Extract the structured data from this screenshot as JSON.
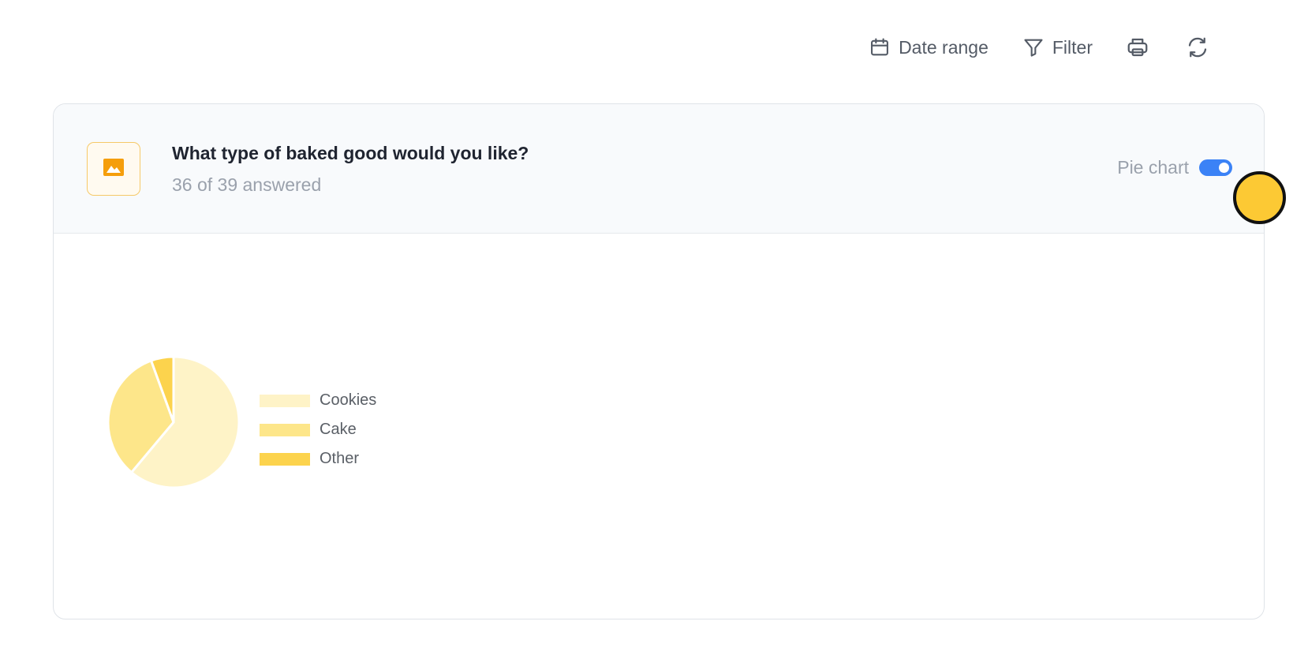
{
  "toolbar": {
    "date_range_label": "Date range",
    "filter_label": "Filter",
    "icons": [
      "calendar-icon",
      "filter-icon",
      "print-icon",
      "refresh-icon"
    ]
  },
  "question": {
    "title": "What type of baked good would you like?",
    "answered": "36 of 39 answered",
    "icon": "image-icon"
  },
  "view_toggle": {
    "label": "Pie chart",
    "enabled": true,
    "color": "#3b82f6"
  },
  "chart_data": {
    "type": "pie",
    "categories": [
      "Cookies",
      "Cake",
      "Other"
    ],
    "values": [
      22,
      12,
      2
    ],
    "colors": [
      "#fef3c7",
      "#fde68a",
      "#fcd34d"
    ],
    "legend_position": "right"
  }
}
